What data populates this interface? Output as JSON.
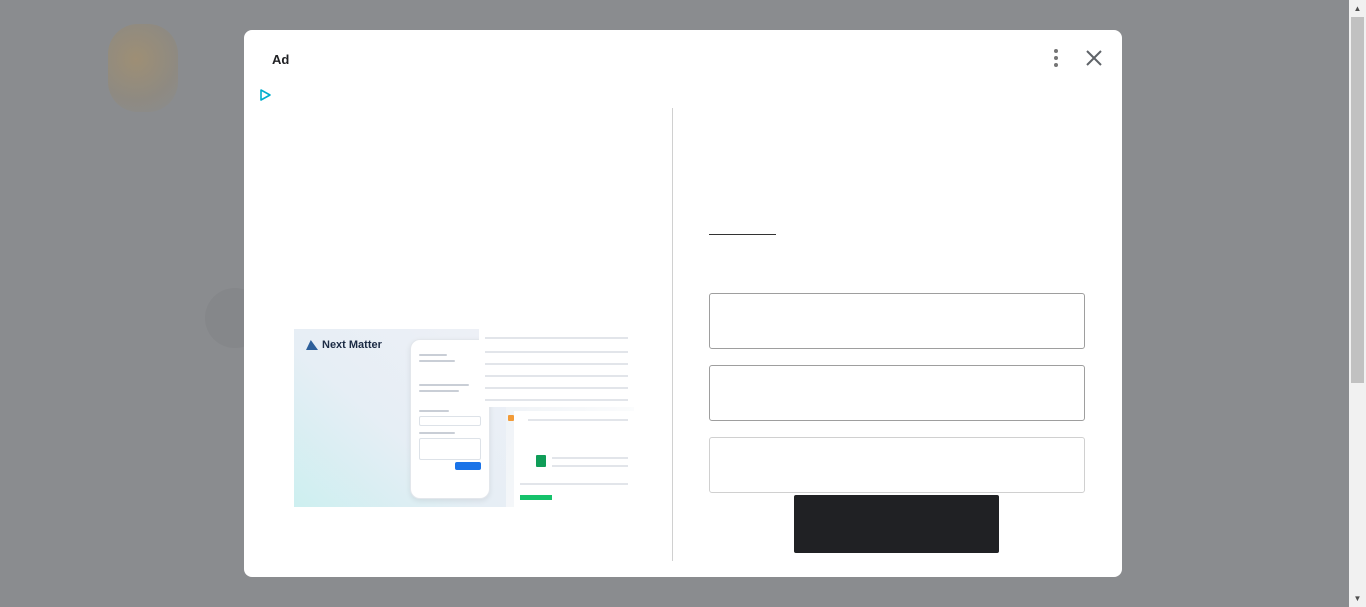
{
  "modal": {
    "ad_label": "Ad",
    "icons": {
      "menu": "more-vert-icon",
      "close": "close-icon",
      "adchoices": "adchoices-play-icon"
    }
  },
  "hero": {
    "brand": "Next Matter"
  },
  "colors": {
    "overlay": "#7c7f82",
    "modal_bg": "#ffffff",
    "cta": "#202124",
    "adchoices": "#00aecd"
  }
}
